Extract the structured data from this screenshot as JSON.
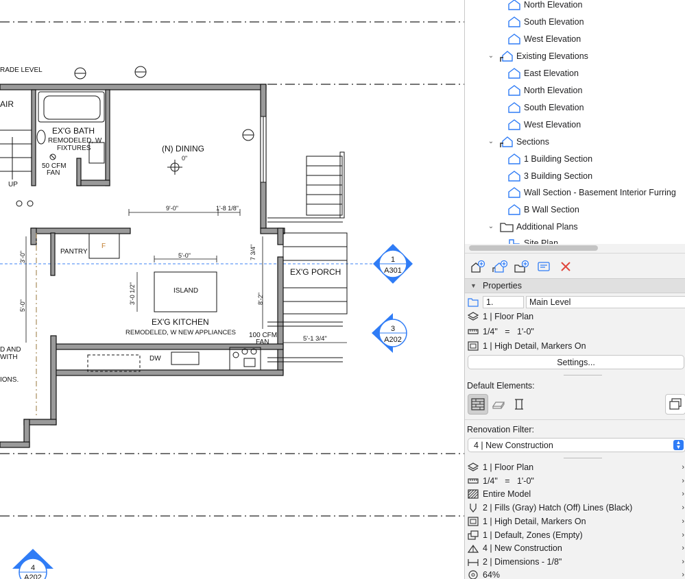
{
  "drawing": {
    "labels": {
      "grade_level": "RADE LEVEL",
      "stair": "AIR",
      "bath_title": "EX'G BATH",
      "bath_note_1": "REMODELED, W",
      "bath_note_2": "FIXTURES",
      "fan_1_a": "50 CFM",
      "fan_1_b": "FAN",
      "up": "UP",
      "dining_title": "(N)  DINING",
      "dining_elev": "0\"",
      "dim_dining_1": "9'-0\"",
      "dim_dining_2": "1'-8 1/8\"",
      "pantry": "PANTRY",
      "fridge": "F",
      "dim_island_w": "5'-0\"",
      "island": "ISLAND",
      "dim_island_h": "3'-0 1/2\"",
      "dim_left_1": "3'-0\"",
      "dim_left_2": "5'-0\"",
      "dim_right_1": "7 3/4\"",
      "dim_right_2": "8'-2\"",
      "porch": "EX'G PORCH",
      "kitchen_title": "EX'G KITCHEN",
      "kitchen_note": "REMODELED, W NEW APPLIANCES",
      "fan_2_a": "100 CFM",
      "fan_2_b": "FAN",
      "dim_porch": "5'-1 3/4\"",
      "dw": "DW",
      "note_left_1": "D AND",
      "note_left_2": "WITH",
      "note_left_3": "IONS."
    },
    "markers": [
      {
        "number": "1",
        "sheet": "A301"
      },
      {
        "number": "3",
        "sheet": "A202"
      },
      {
        "number": "4",
        "sheet": "A202"
      }
    ]
  },
  "tree": {
    "items": [
      {
        "label": "North Elevation",
        "type": "view"
      },
      {
        "label": "South Elevation",
        "type": "view"
      },
      {
        "label": "West Elevation",
        "type": "view"
      },
      {
        "label": "Existing Elevations",
        "type": "group"
      },
      {
        "label": "East Elevation",
        "type": "view"
      },
      {
        "label": "North Elevation",
        "type": "view"
      },
      {
        "label": "South Elevation",
        "type": "view"
      },
      {
        "label": "West Elevation",
        "type": "view"
      },
      {
        "label": "Sections",
        "type": "group"
      },
      {
        "label": "1 Building Section",
        "type": "view"
      },
      {
        "label": "3 Building Section",
        "type": "view"
      },
      {
        "label": "Wall Section - Basement Interior Furring",
        "type": "view"
      },
      {
        "label": "B Wall Section",
        "type": "view"
      },
      {
        "label": "Additional Plans",
        "type": "folder"
      },
      {
        "label": "Site Plan",
        "type": "plan"
      }
    ]
  },
  "toolbar": {
    "icons": [
      "new-view-icon",
      "clone-view-icon",
      "new-folder-icon",
      "view-settings-icon",
      "delete-icon"
    ]
  },
  "properties": {
    "header": "Properties",
    "id_value": "1.",
    "name_value": "Main Level",
    "rows": [
      {
        "label": "1 | Floor Plan",
        "icon": "floor-plan-icon"
      },
      {
        "label": "1/4\"   =   1'-0\"",
        "icon": "scale-icon"
      },
      {
        "label": "1 | High Detail, Markers On",
        "icon": "model-view-icon"
      }
    ],
    "settings_label": "Settings...",
    "default_elements_label": "Default Elements:",
    "renovation_filter_label": "Renovation Filter:",
    "renovation_filter_value": "4 | New Construction",
    "view_rows": [
      {
        "label": "1 | Floor Plan",
        "icon": "floor-plan-icon"
      },
      {
        "label": "1/4\"   =   1'-0\"",
        "icon": "scale-icon"
      },
      {
        "label": "Entire Model",
        "icon": "structure-icon"
      },
      {
        "label": "2 | Fills (Gray) Hatch (Off) Lines (Black)",
        "icon": "pen-set-icon"
      },
      {
        "label": "1 | High Detail, Markers On",
        "icon": "model-view-icon"
      },
      {
        "label": "1 | Default, Zones (Empty)",
        "icon": "graphic-override-icon"
      },
      {
        "label": "4 | New Construction",
        "icon": "renovation-icon"
      },
      {
        "label": "2 | Dimensions - 1/8\"",
        "icon": "dimension-icon"
      },
      {
        "label": "64%",
        "icon": "zoom-icon"
      }
    ]
  },
  "colors": {
    "accent": "#2f7cf6",
    "marker": "#2f7cf6",
    "delete": "#e0463c",
    "section_line": "#3b82f6"
  }
}
